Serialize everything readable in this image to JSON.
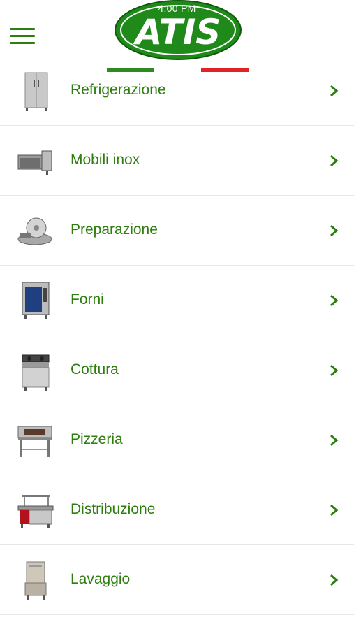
{
  "status": {
    "time": "4:00 PM"
  },
  "header": {
    "logo_text": "ATIS"
  },
  "colors": {
    "brand_green": "#2e7d0f",
    "flag_green": "#2e8b1f",
    "flag_red": "#e02424",
    "divider": "#e6e6e6"
  },
  "categories": [
    {
      "label": "Refrigerazione",
      "icon": "refrigerator-icon"
    },
    {
      "label": "Mobili inox",
      "icon": "stainless-cabinet-icon"
    },
    {
      "label": "Preparazione",
      "icon": "meat-slicer-icon"
    },
    {
      "label": "Forni",
      "icon": "combi-oven-icon"
    },
    {
      "label": "Cottura",
      "icon": "gas-range-icon"
    },
    {
      "label": "Pizzeria",
      "icon": "pizza-oven-icon"
    },
    {
      "label": "Distribuzione",
      "icon": "food-counter-icon"
    },
    {
      "label": "Lavaggio",
      "icon": "dishwasher-icon"
    }
  ]
}
